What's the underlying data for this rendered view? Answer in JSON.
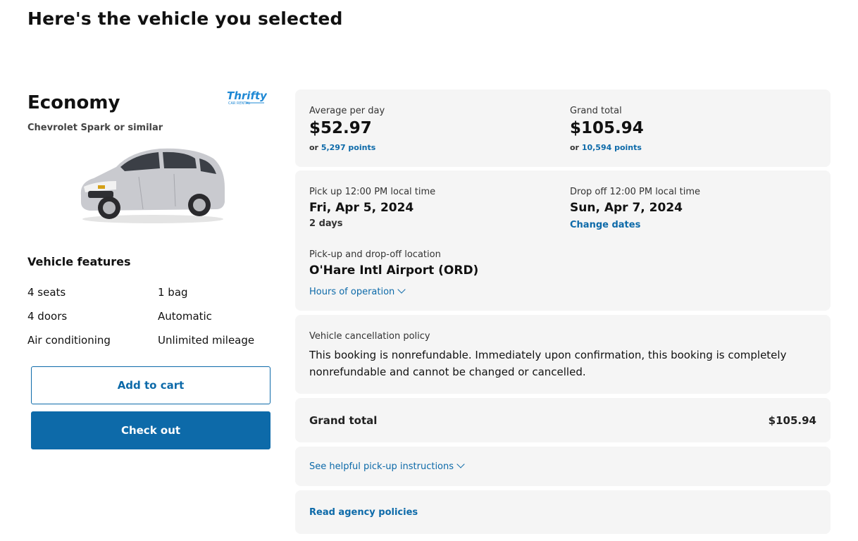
{
  "page": {
    "title": "Here's the vehicle you selected"
  },
  "vehicle": {
    "class": "Economy",
    "model": "Chevrolet Spark or similar",
    "vendor_logo_text": "Thrifty",
    "vendor_logo_sub": "CAR RENTAL",
    "features_title": "Vehicle features",
    "features": [
      "4 seats",
      "1 bag",
      "4 doors",
      "Automatic",
      "Air conditioning",
      "Unlimited mileage"
    ]
  },
  "actions": {
    "add_to_cart": "Add to cart",
    "check_out": "Check out"
  },
  "pricing": {
    "avg_label": "Average per day",
    "avg_price": "$52.97",
    "avg_points_prefix": "or ",
    "avg_points": "5,297 points",
    "total_label": "Grand total",
    "total_price": "$105.94",
    "total_points_prefix": "or ",
    "total_points": "10,594 points"
  },
  "trip": {
    "pickup_label": "Pick up 12:00 PM local time",
    "pickup_date": "Fri, Apr 5, 2024",
    "duration": "2 days",
    "dropoff_label": "Drop off 12:00 PM local time",
    "dropoff_date": "Sun, Apr 7, 2024",
    "change_dates": "Change dates",
    "location_label": "Pick-up and drop-off location",
    "location": "O'Hare Intl Airport (ORD)",
    "hours_link": "Hours of operation"
  },
  "cancellation": {
    "title": "Vehicle cancellation policy",
    "text": "This booking is nonrefundable. Immediately upon confirmation, this booking is completely nonrefundable and cannot be changed or cancelled."
  },
  "summary": {
    "label": "Grand total",
    "value": "$105.94"
  },
  "links": {
    "pickup_instructions": "See helpful pick-up instructions",
    "agency_policies": "Read agency policies"
  },
  "colors": {
    "accent": "#0d6aa9",
    "card_bg": "#f5f5f5",
    "vendor_logo": "#1e88d4"
  }
}
